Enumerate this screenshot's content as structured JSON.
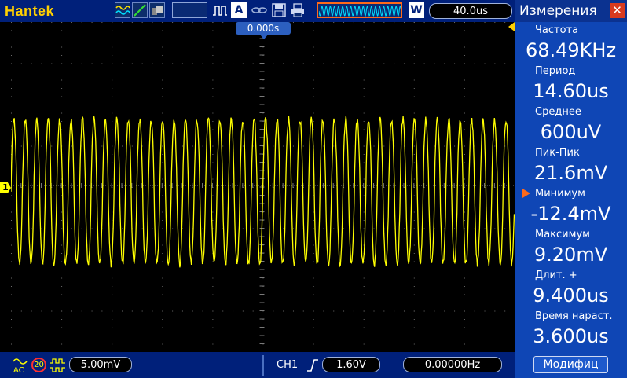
{
  "topbar": {
    "brand": "Hantek",
    "timebase": "40.0us",
    "zoom_button": "W",
    "acquire_mode": "A",
    "trigger_position": "0.000s"
  },
  "bottombar": {
    "ch1_volts_div": "5.00mV",
    "bandwidth_badge": "20",
    "trigger_source": "CH1",
    "trigger_level": "1.60V",
    "trigger_freq": "0.00000Hz"
  },
  "waveform": {
    "color": "#ffff00",
    "channel_marker": "1",
    "cycles_on_screen": 44
  },
  "measurements": {
    "title": "Измерения",
    "items": [
      {
        "label": "Частота",
        "value": "68.49KHz"
      },
      {
        "label": "Период",
        "value": "14.60us"
      },
      {
        "label": "Среднее",
        "value": "600uV"
      },
      {
        "label": "Пик-Пик",
        "value": "21.6mV"
      },
      {
        "label": "Минимум",
        "value": "-12.4mV"
      },
      {
        "label": "Максимум",
        "value": "9.20mV"
      },
      {
        "label": "Длит.  +",
        "value": "9.400us"
      },
      {
        "label": "Время  нараст.",
        "value": "3.600us"
      }
    ],
    "selected_index": 4,
    "modify_button": "Модифиц"
  },
  "colors": {
    "bar_bg": "#00207a",
    "panel_bg": "#0f46b5",
    "trace": "#ffff00",
    "accent_orange": "#ff6a1a",
    "brand": "#ffd000"
  }
}
